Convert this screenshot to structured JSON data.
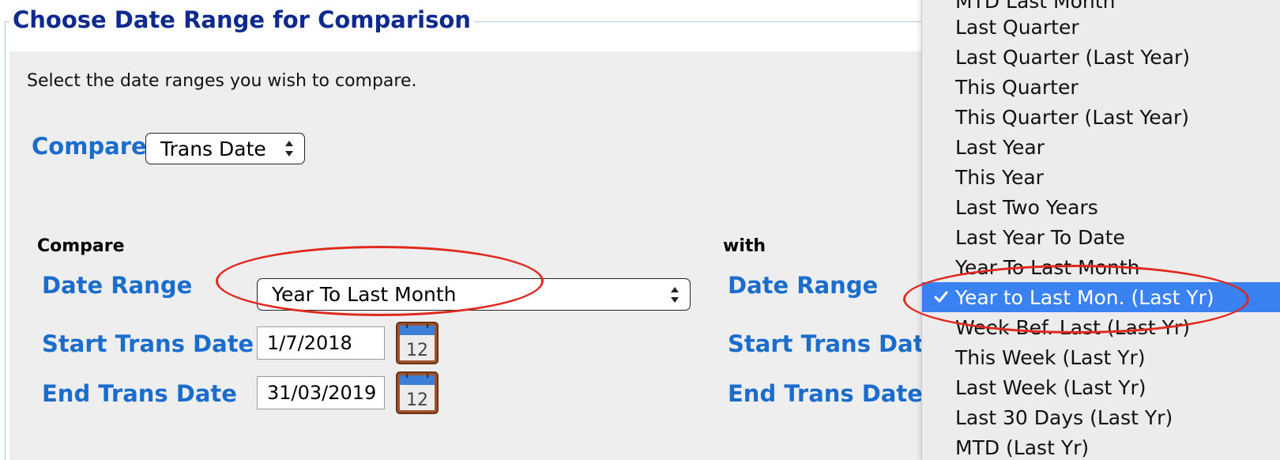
{
  "legend": "Choose Date Range for Comparison",
  "instructions": "Select the date ranges you wish to compare.",
  "compare_by": {
    "label": "Compare",
    "selected": "Trans Date"
  },
  "left_range": {
    "heading": "Compare",
    "date_range_label": "Date Range",
    "date_range_value": "Year To Last Month",
    "start_label": "Start Trans Date",
    "start_value": "1/7/2018",
    "end_label": "End Trans Date",
    "end_value": "31/03/2019",
    "calendar_day": "12"
  },
  "right_range": {
    "heading": "with",
    "date_range_label": "Date Range",
    "start_label": "Start Trans Date",
    "end_label": "End Trans Date"
  },
  "dropdown": {
    "items": [
      "MTD Last Month",
      "Last Quarter",
      "Last Quarter (Last Year)",
      "This Quarter",
      "This Quarter (Last Year)",
      "Last Year",
      "This Year",
      "Last Two Years",
      "Last Year To Date",
      "Year To Last Month",
      "Year to Last Mon. (Last Yr)",
      "Week Bef. Last (Last Yr)",
      "This Week (Last Yr)",
      "Last Week (Last Yr)",
      "Last 30 Days (Last Yr)",
      "MTD (Last Yr)"
    ],
    "selected_index": 10
  },
  "colors": {
    "label_blue": "#1a6dcc",
    "legend_navy": "#0f2a8e",
    "selection_blue": "#3a82f2",
    "annotation_red": "#e0281e"
  }
}
